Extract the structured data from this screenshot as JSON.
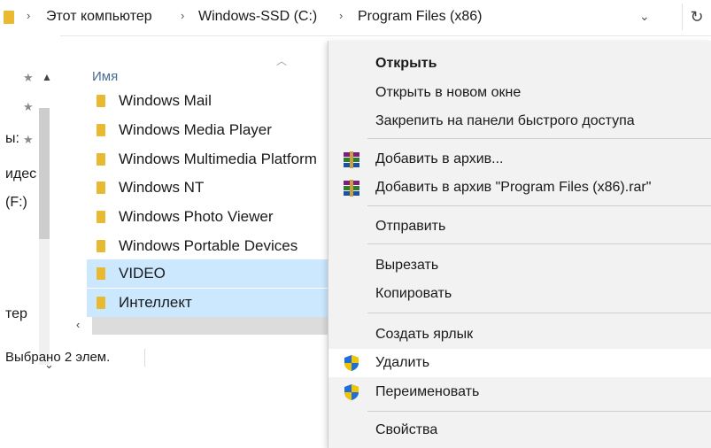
{
  "address": {
    "crumbs": [
      "Этот компьютер",
      "Windows-SSD (C:)",
      "Program Files (x86)"
    ],
    "separator": "›",
    "dropdown_icon": "⌄",
    "refresh_icon": "↻"
  },
  "nav": {
    "items": [
      "ы:",
      "идес",
      "(F:)",
      "тер"
    ]
  },
  "list": {
    "column_header": "Имя",
    "files": [
      {
        "name": "Windows Mail",
        "selected": false
      },
      {
        "name": "Windows Media Player",
        "selected": false
      },
      {
        "name": "Windows Multimedia Platform",
        "selected": false
      },
      {
        "name": "Windows NT",
        "selected": false
      },
      {
        "name": "Windows Photo Viewer",
        "selected": false
      },
      {
        "name": "Windows Portable Devices",
        "selected": false
      },
      {
        "name": "VIDEO",
        "selected": true
      },
      {
        "name": "Интеллект",
        "selected": true
      }
    ]
  },
  "status": {
    "text": "Выбрано 2 элем."
  },
  "context_menu": {
    "items": [
      {
        "label": "Открыть",
        "bold": true,
        "icon": ""
      },
      {
        "label": "Открыть в новом окне",
        "icon": ""
      },
      {
        "label": "Закрепить на панели быстрого доступа",
        "icon": ""
      },
      {
        "label": "Добавить в архив...",
        "icon": "winrar-icon"
      },
      {
        "label": "Добавить в архив \"Program Files (x86).rar\"",
        "icon": "winrar-icon"
      },
      {
        "label": "Отправить",
        "icon": ""
      },
      {
        "label": "Вырезать",
        "icon": ""
      },
      {
        "label": "Копировать",
        "icon": ""
      },
      {
        "label": "Создать ярлык",
        "icon": ""
      },
      {
        "label": "Удалить",
        "icon": "uac-shield-icon",
        "hover": true
      },
      {
        "label": "Переименовать",
        "icon": "uac-shield-icon"
      },
      {
        "label": "Свойства",
        "icon": ""
      }
    ]
  },
  "colors": {
    "selection": "#cce8ff",
    "menu_bg": "#f2f2f2",
    "folder": "#e8b931",
    "header_text": "#4a6c8f"
  }
}
